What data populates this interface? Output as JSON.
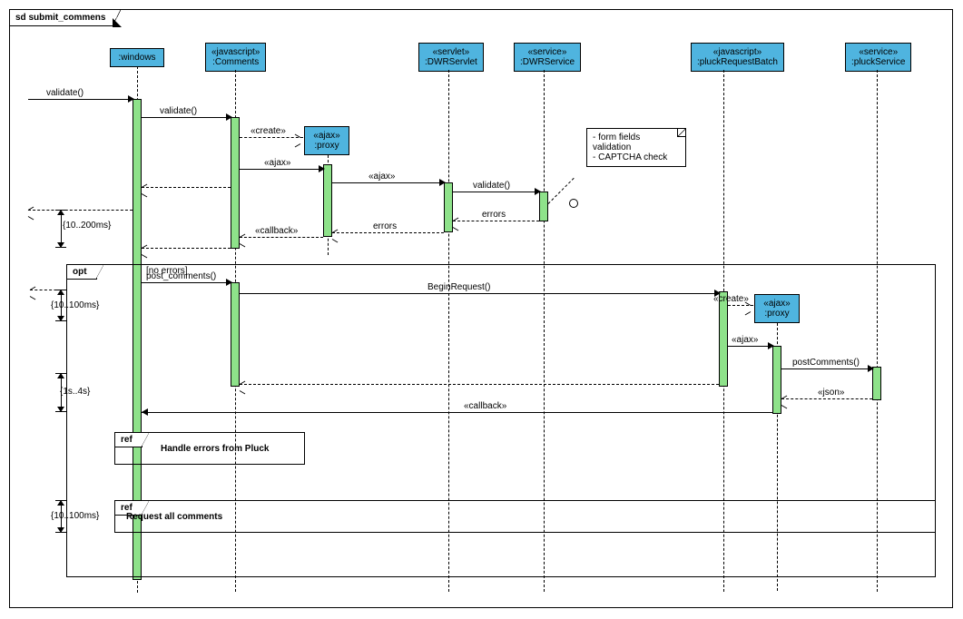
{
  "frame_title": "sd submit_commens",
  "lifelines": {
    "windows": {
      "name": ":windows"
    },
    "comments": {
      "stereo": "«javascript»",
      "name": ":Comments"
    },
    "proxy1": {
      "stereo": "«ajax»",
      "name": ":proxy"
    },
    "dwrservlet": {
      "stereo": "«servlet»",
      "name": ":DWRServlet"
    },
    "dwrservice": {
      "stereo": "«service»",
      "name": ":DWRService"
    },
    "pluckbatch": {
      "stereo": "«javascript»",
      "name": ":pluckRequestBatch"
    },
    "proxy2": {
      "stereo": "«ajax»",
      "name": ":proxy"
    },
    "pluckservice": {
      "stereo": "«service»",
      "name": ":pluckService"
    }
  },
  "messages": {
    "m_validate_in": "validate()",
    "m_validate_js": "validate()",
    "m_create1": "«create»",
    "m_ajax1": "«ajax»",
    "m_ajax2": "«ajax»",
    "m_validate_svc": "validate()",
    "m_errors1": "errors",
    "m_errors2": "errors",
    "m_callback1": "«callback»",
    "m_guard": "[no errors]",
    "m_postc": "post_comments()",
    "m_begin": "BeginRequest()",
    "m_create2": "«create»",
    "m_ajax3": "«ajax»",
    "m_postcomments": "postComments()",
    "m_json": "«json»",
    "m_callback2": "«callback»"
  },
  "note": {
    "l1": "- form fields",
    "l2": "validation",
    "l3": "- CAPTCHA check"
  },
  "combined": {
    "opt": "opt",
    "ref1": "ref",
    "ref1_title": "Handle errors from Pluck",
    "ref2": "ref",
    "ref2_title": "Request all comments"
  },
  "durations": {
    "d1": "{10..200ms}",
    "d2": "{10..100ms}",
    "d3": "{1s..4s}",
    "d4": "{10..100ms}"
  }
}
